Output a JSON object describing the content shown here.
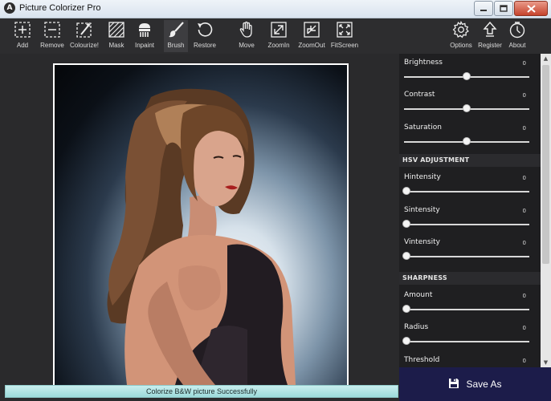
{
  "window": {
    "title": "Picture Colorizer Pro",
    "icon_letter": "A"
  },
  "toolbar": {
    "tools": [
      {
        "label": "Add",
        "icon": "add-icon"
      },
      {
        "label": "Remove",
        "icon": "remove-icon"
      },
      {
        "label": "Colourize!",
        "icon": "colourize-icon"
      },
      {
        "label": "Mask",
        "icon": "mask-icon"
      },
      {
        "label": "Inpaint",
        "icon": "inpaint-icon"
      },
      {
        "label": "Brush",
        "icon": "brush-icon",
        "active": true
      },
      {
        "label": "Restore",
        "icon": "restore-icon"
      },
      {
        "label": "Move",
        "icon": "hand-icon"
      },
      {
        "label": "ZoomIn",
        "icon": "zoom-in-icon"
      },
      {
        "label": "ZoomOut",
        "icon": "zoom-out-icon"
      },
      {
        "label": "FitScreen",
        "icon": "fit-screen-icon"
      },
      {
        "label": "Options",
        "icon": "gear-icon"
      },
      {
        "label": "Register",
        "icon": "register-icon"
      },
      {
        "label": "About",
        "icon": "about-icon"
      }
    ]
  },
  "panel": {
    "sliders_top": [
      {
        "name": "Brightness",
        "value": "0",
        "position": 0.5
      },
      {
        "name": "Contrast",
        "value": "0",
        "position": 0.5
      },
      {
        "name": "Saturation",
        "value": "0",
        "position": 0.5
      }
    ],
    "hsv_title": "HSV ADJUSTMENT",
    "sliders_hsv": [
      {
        "name": "Hintensity",
        "value": "0",
        "position": 0
      },
      {
        "name": "Sintensity",
        "value": "0",
        "position": 0
      },
      {
        "name": "Vintensity",
        "value": "0",
        "position": 0
      }
    ],
    "sharp_title": "SHARPNESS",
    "sliders_sharp": [
      {
        "name": "Amount",
        "value": "0",
        "position": 0
      },
      {
        "name": "Radius",
        "value": "0",
        "position": 0
      },
      {
        "name": "Threshold",
        "value": "0",
        "position": 0
      }
    ]
  },
  "save_button": {
    "label": "Save As"
  },
  "status": {
    "text": "Colorize B&W picture Successfully"
  },
  "colors": {
    "accent": "#1c1c4a",
    "status_bg": "#b4e4e4",
    "panel_bg": "#1f1f21"
  }
}
